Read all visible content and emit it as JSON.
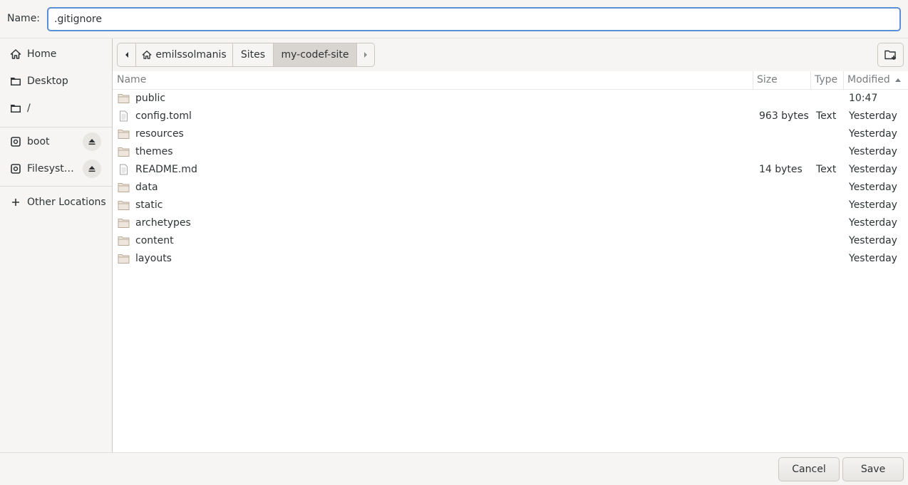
{
  "name_row": {
    "label": "Name:",
    "value": ".gitignore"
  },
  "sidebar": {
    "items": [
      {
        "label": "Home",
        "icon": "home-icon"
      },
      {
        "label": "Desktop",
        "icon": "folder-icon"
      },
      {
        "label": "/",
        "icon": "folder-icon"
      }
    ],
    "devices": [
      {
        "label": "boot",
        "icon": "drive-icon",
        "eject": "eject-icon"
      },
      {
        "label": "Filesyst…",
        "icon": "drive-icon",
        "eject": "eject-icon"
      }
    ],
    "other": {
      "label": "Other Locations",
      "icon": "plus-icon"
    }
  },
  "pathbar": {
    "segments": [
      "emilssolmanis",
      "Sites",
      "my-codef-site"
    ],
    "active": "my-codef-site"
  },
  "columns": {
    "name": "Name",
    "size": "Size",
    "type": "Type",
    "modified": "Modified"
  },
  "files": [
    {
      "name": "public",
      "kind": "folder",
      "size": "",
      "type": "",
      "modified": "10:47"
    },
    {
      "name": "config.toml",
      "kind": "file",
      "size": "963 bytes",
      "type": "Text",
      "modified": "Yesterday"
    },
    {
      "name": "resources",
      "kind": "folder",
      "size": "",
      "type": "",
      "modified": "Yesterday"
    },
    {
      "name": "themes",
      "kind": "folder",
      "size": "",
      "type": "",
      "modified": "Yesterday"
    },
    {
      "name": "README.md",
      "kind": "file",
      "size": "14 bytes",
      "type": "Text",
      "modified": "Yesterday"
    },
    {
      "name": "data",
      "kind": "folder",
      "size": "",
      "type": "",
      "modified": "Yesterday"
    },
    {
      "name": "static",
      "kind": "folder",
      "size": "",
      "type": "",
      "modified": "Yesterday"
    },
    {
      "name": "archetypes",
      "kind": "folder",
      "size": "",
      "type": "",
      "modified": "Yesterday"
    },
    {
      "name": "content",
      "kind": "folder",
      "size": "",
      "type": "",
      "modified": "Yesterday"
    },
    {
      "name": "layouts",
      "kind": "folder",
      "size": "",
      "type": "",
      "modified": "Yesterday"
    }
  ],
  "buttons": {
    "cancel": "Cancel",
    "save": "Save"
  },
  "colors": {
    "focus": "#5a8fd4",
    "folder": "#c8b9a6",
    "active_crumb": "#d8d4d0"
  }
}
